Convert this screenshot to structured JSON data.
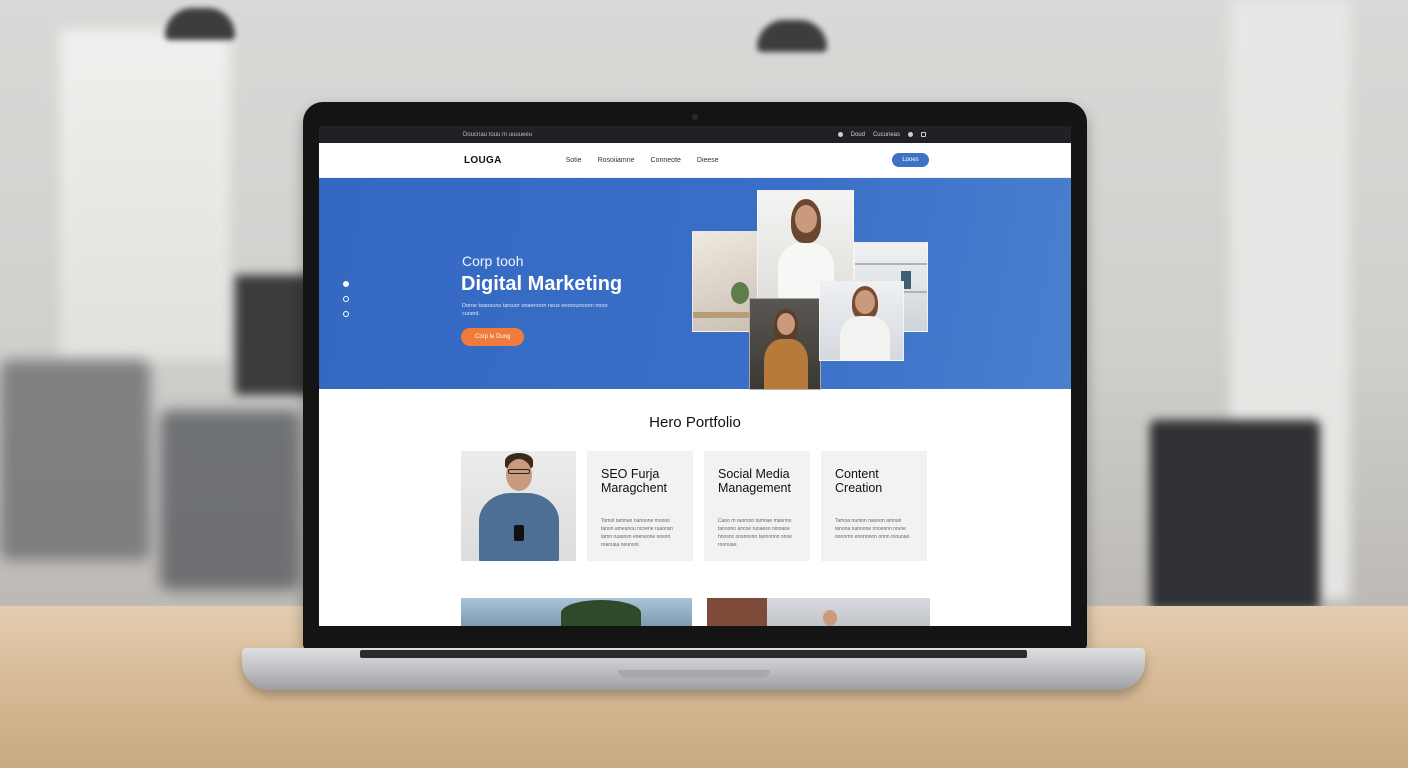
{
  "topbar": {
    "left_text": "Doucnau touu m uuuueeu",
    "right_items": [
      "Doud",
      "Cucuneas"
    ]
  },
  "nav": {
    "logo": "LOUGA",
    "menu": [
      "Sotie",
      "Rosoiiamne",
      "Conneote",
      "Dieese"
    ],
    "cta": "Looes"
  },
  "hero": {
    "pretitle": "Corp tooh",
    "title": "Digital Marketing",
    "description": "Doroe toaoouns tarsuor onaeroron neus eoorounooon nnoo cuoenl.",
    "button": "Corp le Dung",
    "slides": [
      true,
      false,
      false
    ]
  },
  "portfolio": {
    "title": "Hero Portfolio",
    "cards": [
      {
        "title": "SEO Furja Maragchent",
        "body": "Tomol tamnan nanoone moooo tanon ameunou ncnene ruaonsn tamn ruaonsn eneneone oosnn roanuaa neunonl."
      },
      {
        "title": "Social Media Management",
        "body": "Caoo m raornon tamnae masnno tanoono ancoe ruoaeso ninoaoe hnosnc onsnnsnn tannonnn onoe roonuae."
      },
      {
        "title": "Content Creation",
        "body": "Tamoa nanton naooon amnan tanona nanoone nnoesnn nrune oonnrnn enonnnon onnn roouoae."
      }
    ]
  },
  "colors": {
    "hero_blue": "#3a6fc7",
    "hero_button": "#f07b3a",
    "nav_cta": "#3f72c6",
    "topbar": "#202124"
  }
}
